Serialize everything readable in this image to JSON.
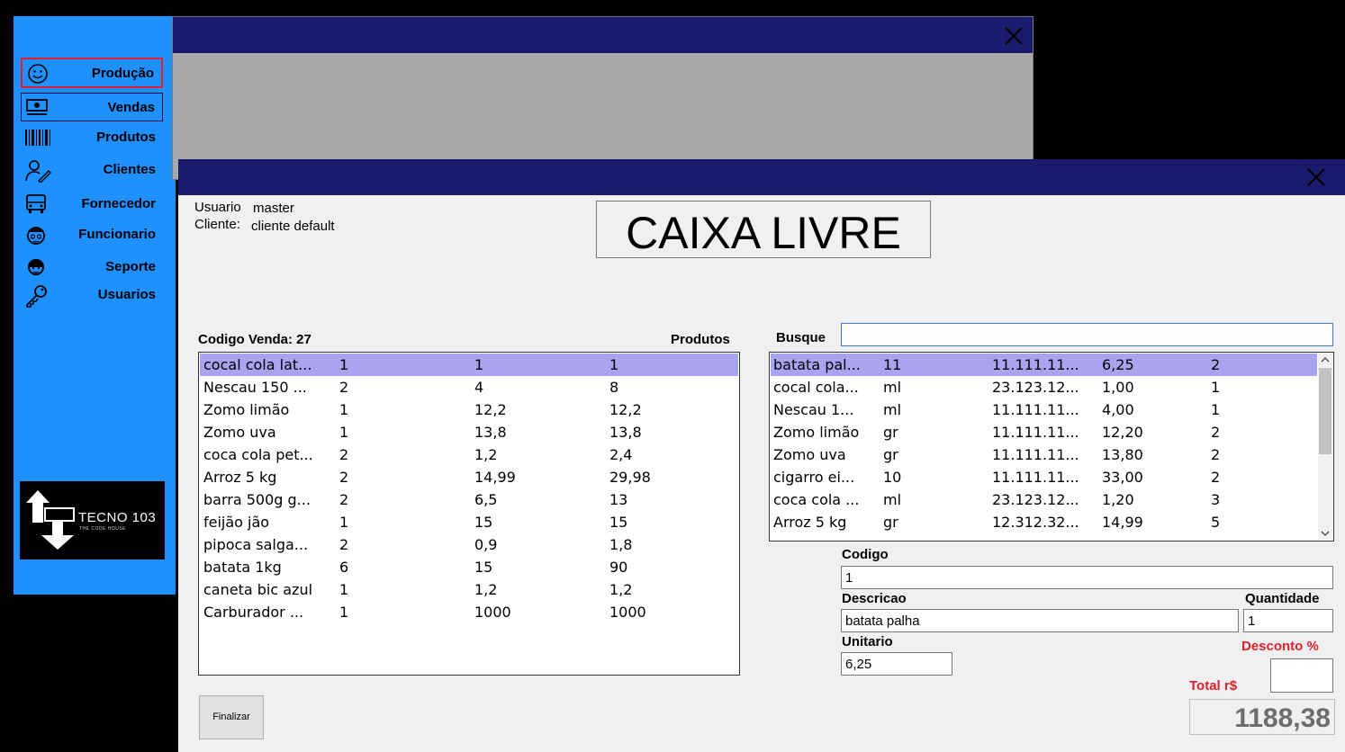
{
  "sidebar": {
    "items": [
      {
        "label": "Produção",
        "icon": "smiley-icon"
      },
      {
        "label": "Vendas",
        "icon": "money-icon"
      },
      {
        "label": "Produtos",
        "icon": "barcode-icon"
      },
      {
        "label": "Clientes",
        "icon": "user-edit-icon"
      },
      {
        "label": "Fornecedor",
        "icon": "truck-icon"
      },
      {
        "label": "Funcionario",
        "icon": "worker-icon"
      },
      {
        "label": "Seporte",
        "icon": "support-agent-icon"
      },
      {
        "label": "Usuarios",
        "icon": "key-icon"
      }
    ],
    "logo": {
      "name": "TECNO 103",
      "tagline": "THE CODE HOUSE"
    }
  },
  "pdv": {
    "usuario_label": "Usuario",
    "usuario": "master",
    "cliente_label": "Cliente:",
    "cliente": "cliente default",
    "status": "CAIXA LIVRE",
    "codigo_venda": "Codigo Venda: 27",
    "produtos_label": "Produtos",
    "busque_label": "Busque",
    "busque_value": "",
    "sale_items": [
      [
        "cocal cola lat...",
        "1",
        "1",
        "1"
      ],
      [
        "Nescau  150 ...",
        "2",
        "4",
        "8"
      ],
      [
        "Zomo limão",
        "1",
        "12,2",
        "12,2"
      ],
      [
        "Zomo uva",
        "1",
        "13,8",
        "13,8"
      ],
      [
        "coca cola pet...",
        "2",
        "1,2",
        "2,4"
      ],
      [
        "Arroz 5 kg",
        "2",
        "14,99",
        "29,98"
      ],
      [
        "barra 500g g...",
        "2",
        "6,5",
        "13"
      ],
      [
        "feijão jão",
        "1",
        "15",
        "15"
      ],
      [
        "pipoca salga...",
        "2",
        "0,9",
        "1,8"
      ],
      [
        "batata 1kg",
        "6",
        "15",
        "90"
      ],
      [
        "caneta bic azul",
        "1",
        "1,2",
        "1,2"
      ],
      [
        "Carburador ...",
        "1",
        "1000",
        "1000"
      ]
    ],
    "products": [
      [
        "batata pal...",
        "11",
        "11.111.11...",
        "6,25",
        "2"
      ],
      [
        "cocal cola...",
        "ml",
        "23.123.12...",
        "1,00",
        "1"
      ],
      [
        "Nescau  1...",
        "ml",
        "11.111.11...",
        "4,00",
        "1"
      ],
      [
        "Zomo limão",
        "gr",
        "11.111.11...",
        "12,20",
        "2"
      ],
      [
        "Zomo uva",
        "gr",
        "11.111.11...",
        "13,80",
        "2"
      ],
      [
        "cigarro ei...",
        "10",
        "11.111.11...",
        "33,00",
        "2"
      ],
      [
        "coca cola ...",
        "ml",
        "23.123.12...",
        "1,20",
        "3"
      ],
      [
        "Arroz 5 kg",
        "gr",
        "12.312.32...",
        "14,99",
        "5"
      ]
    ],
    "codigo_label": "Codigo",
    "codigo": "1",
    "descricao_label": "Descricao",
    "descricao": "batata palha",
    "quantidade_label": "Quantidade",
    "quantidade": "1",
    "unitario_label": "Unitario",
    "unitario": "6,25",
    "desconto_label": "Desconto %",
    "desconto": "",
    "total_label": "Total r$",
    "total": "1188,38",
    "finalizar": "Finalizar"
  },
  "colors": {
    "sidebar": "#1e90ff",
    "titlebar": "#1b1b6e",
    "selection": "#a9a3f0",
    "red": "#e0202a"
  }
}
